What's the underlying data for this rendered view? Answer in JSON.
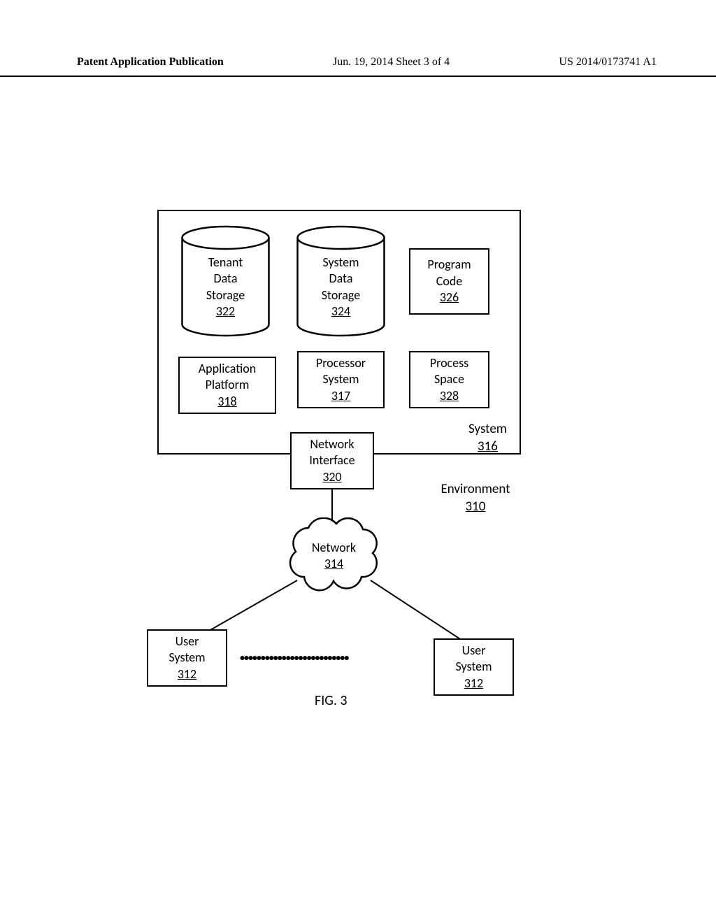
{
  "header": {
    "left": "Patent Application Publication",
    "center": "Jun. 19, 2014  Sheet 3 of 4",
    "right": "US 2014/0173741 A1"
  },
  "boxes": {
    "tenant": {
      "l1": "Tenant",
      "l2": "Data",
      "l3": "Storage",
      "ref": "322"
    },
    "sysdata": {
      "l1": "System",
      "l2": "Data",
      "l3": "Storage",
      "ref": "324"
    },
    "prog": {
      "l1": "Program",
      "l2": "Code",
      "ref": "326"
    },
    "app": {
      "l1": "Application",
      "l2": "Platform",
      "ref": "318"
    },
    "proc": {
      "l1": "Processor",
      "l2": "System",
      "ref": "317"
    },
    "pspace": {
      "l1": "Process",
      "l2": "Space",
      "ref": "328"
    },
    "netif": {
      "l1": "Network",
      "l2": "Interface",
      "ref": "320"
    },
    "net": {
      "l1": "Network",
      "ref": "314"
    },
    "user1": {
      "l1": "User",
      "l2": "System",
      "ref": "312"
    },
    "user2": {
      "l1": "User",
      "l2": "System",
      "ref": "312"
    }
  },
  "labels": {
    "system": {
      "l1": "System",
      "ref": "316"
    },
    "env": {
      "l1": "Environment",
      "ref": "310"
    }
  },
  "figure": "FIG. 3",
  "dots": "••••••••••••••••••••••••••"
}
